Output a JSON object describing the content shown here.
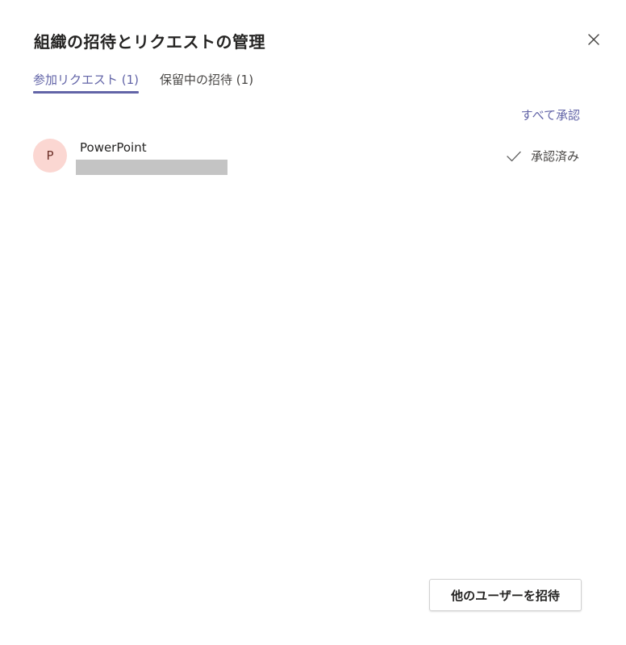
{
  "dialog": {
    "title": "組織の招待とリクエストの管理",
    "close_icon": "close-icon"
  },
  "tabs": [
    {
      "label": "参加リクエスト (1)",
      "active": true
    },
    {
      "label": "保留中の招待 (1)",
      "active": false
    }
  ],
  "actions": {
    "approve_all_label": "すべて承認",
    "invite_button_label": "他のユーザーを招待"
  },
  "requests": [
    {
      "avatar_initial": "P",
      "name": "PowerPoint",
      "status_label": "承認済み",
      "status_icon": "check-icon"
    }
  ],
  "colors": {
    "accent": "#6264a7",
    "avatar_bg": "#fbd7d2",
    "avatar_text": "#6d3129",
    "redaction": "#c4c4c4"
  }
}
